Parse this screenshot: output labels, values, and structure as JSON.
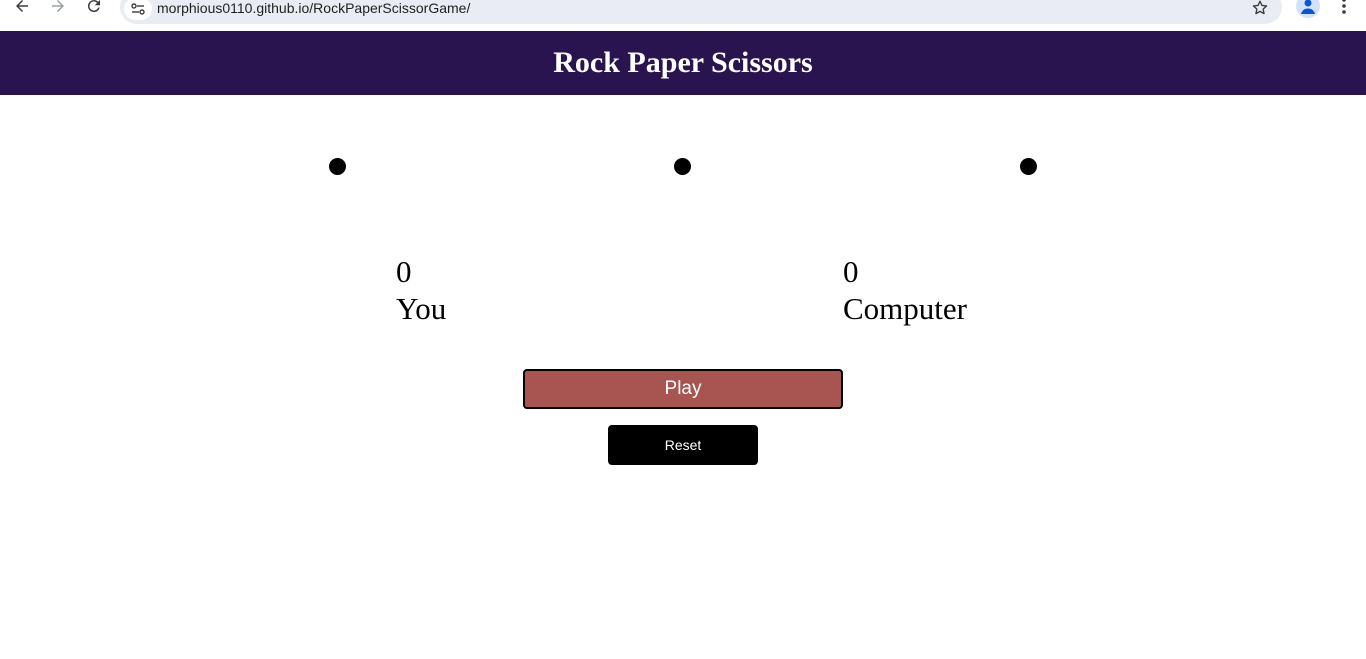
{
  "browser": {
    "url": "morphious0110.github.io/RockPaperScissorGame/",
    "icons": [
      "back-icon",
      "forward-icon",
      "reload-icon",
      "site-info-icon",
      "star-icon",
      "profile-icon",
      "more-icon"
    ]
  },
  "header": {
    "title": "Rock Paper Scissors",
    "background": "#2a1450"
  },
  "choices": [
    "choice-1",
    "choice-2",
    "choice-3"
  ],
  "scores": {
    "user": {
      "value": "0",
      "label": "You"
    },
    "computer": {
      "value": "0",
      "label": "Computer"
    }
  },
  "buttons": {
    "play_label": "Play",
    "play_color": "#a85450",
    "reset_label": "Reset",
    "reset_color": "#000000"
  }
}
